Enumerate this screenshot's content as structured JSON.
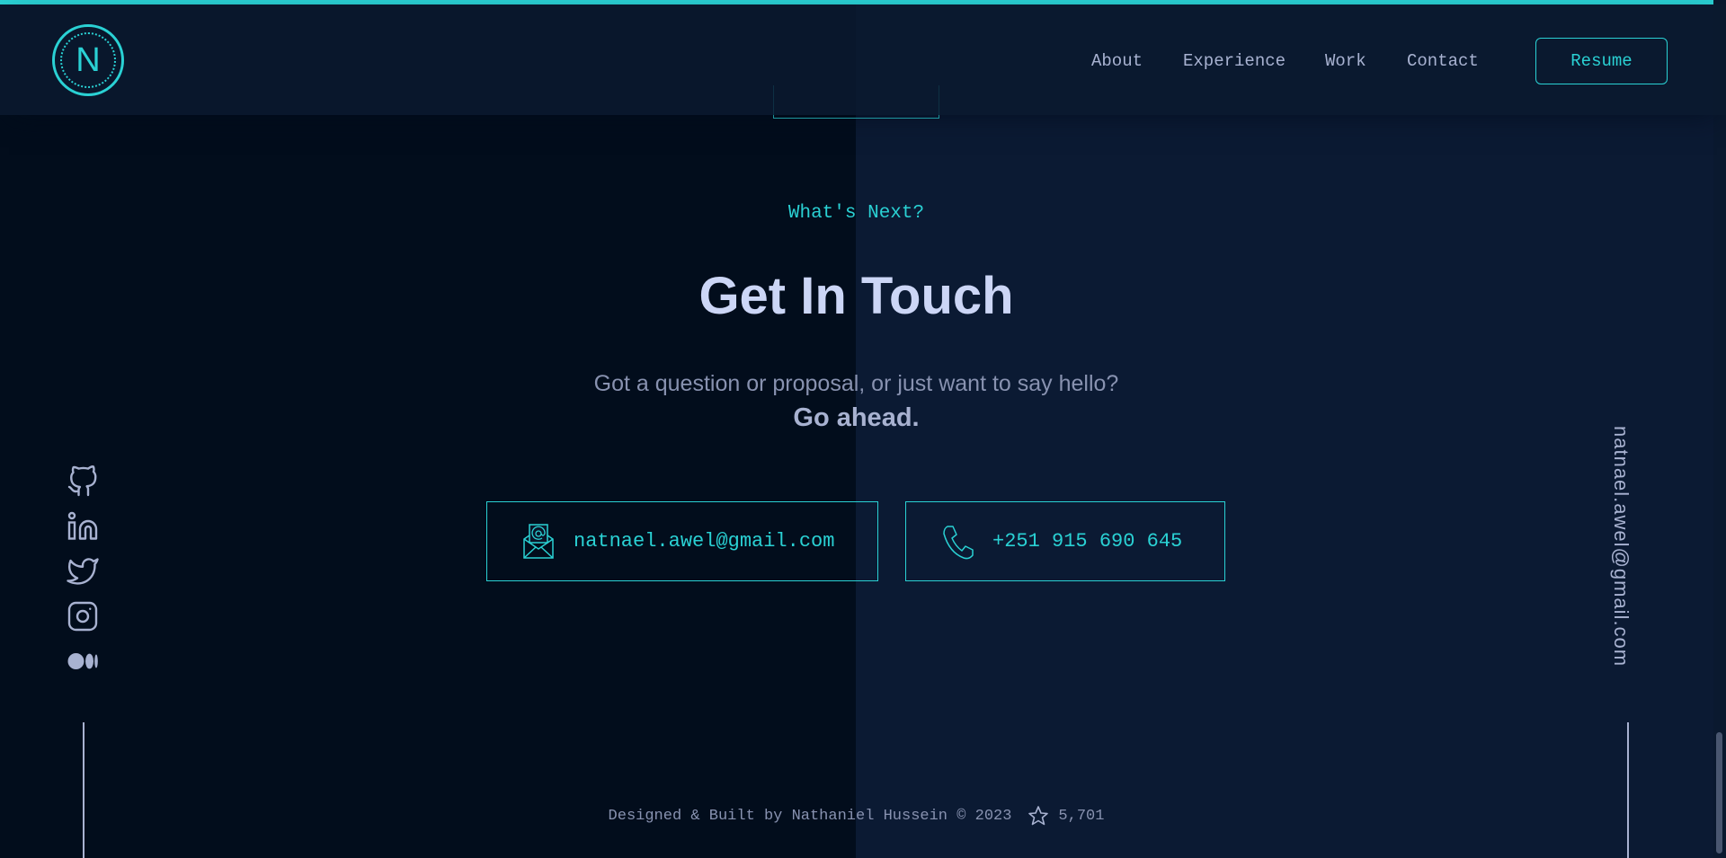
{
  "header": {
    "logo_letter": "N",
    "nav": [
      "About",
      "Experience",
      "Work",
      "Contact"
    ],
    "resume_label": "Resume"
  },
  "contact": {
    "overline": "What's Next?",
    "title": "Get In Touch",
    "subtitle": "Got a question or proposal, or just want to say hello?",
    "subtitle_strong": "Go ahead.",
    "email": "natnael.awel@gmail.com",
    "phone": "+251 915 690 645"
  },
  "social": {
    "icons": [
      "github-icon",
      "linkedin-icon",
      "twitter-icon",
      "instagram-icon",
      "medium-icon"
    ],
    "side_email": "natnael.awel@gmail.com"
  },
  "footer": {
    "credit": "Designed & Built by Nathaniel Hussein © 2023",
    "stars": "5,701"
  },
  "colors": {
    "accent": "#2ad1d4",
    "background": "#0a192f",
    "text_light": "#ccd6f6",
    "text_slate": "#8892b0"
  }
}
